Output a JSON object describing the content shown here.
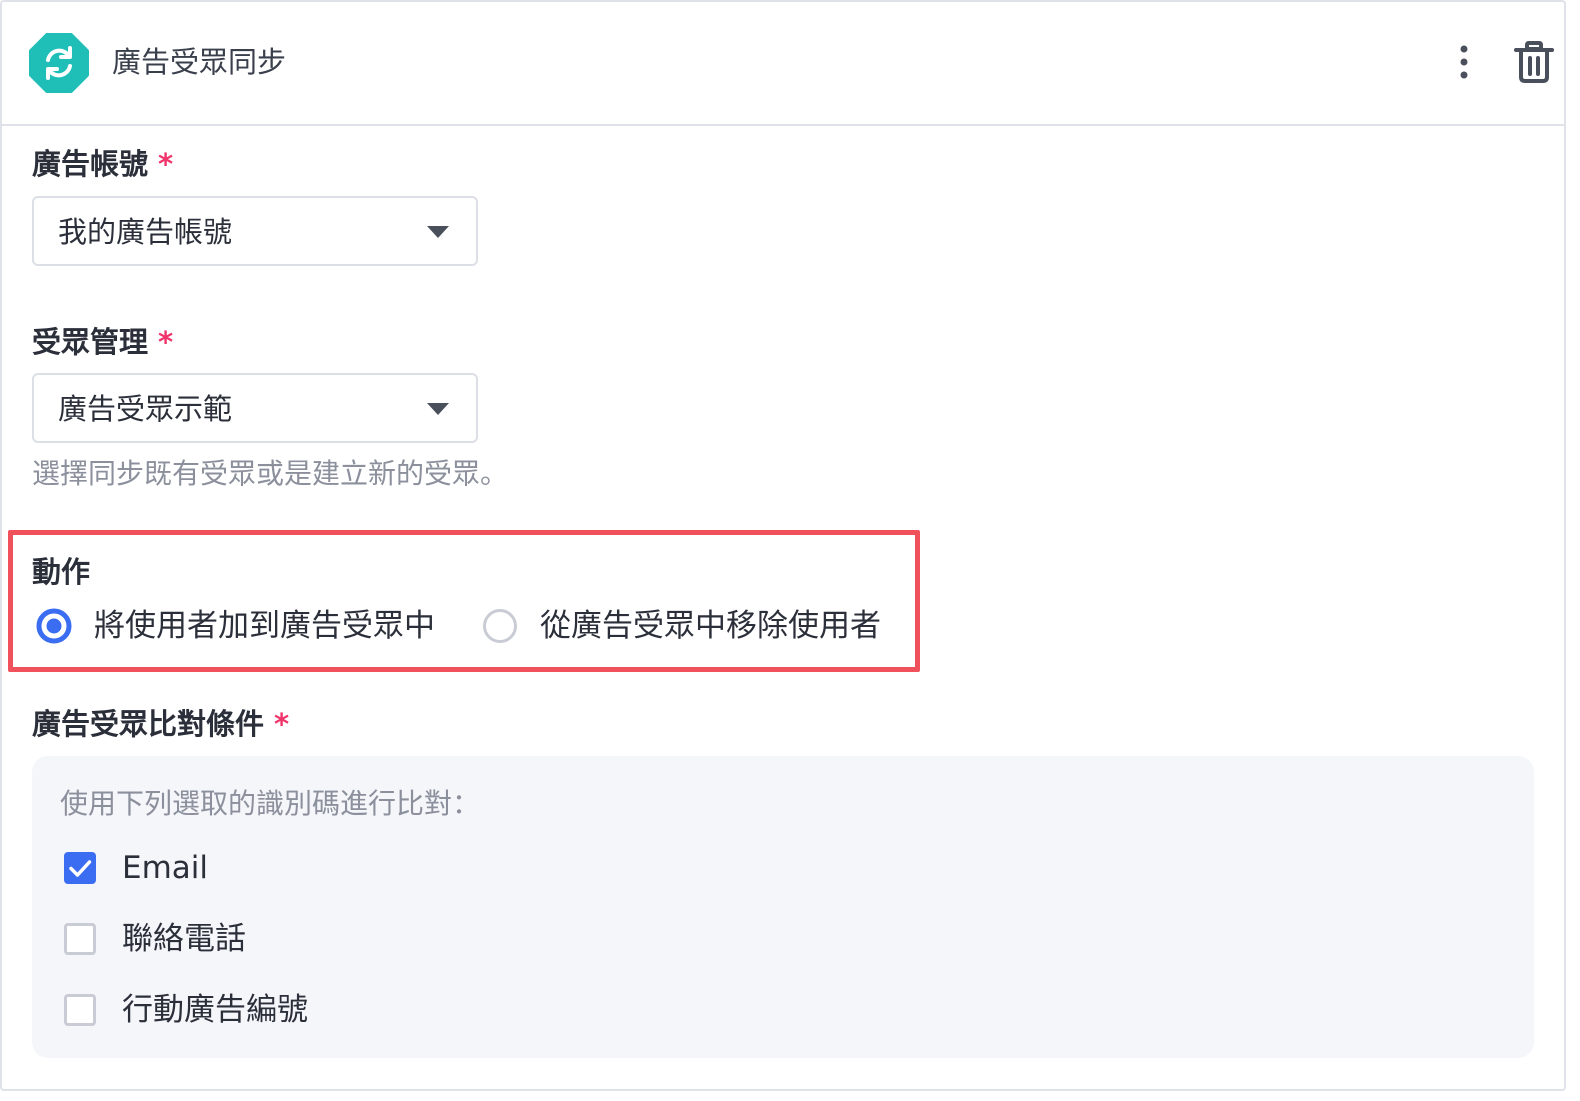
{
  "header": {
    "title": "廣告受眾同步",
    "logo_icon": "sync-icon",
    "menu_icon": "more-vertical-icon",
    "delete_icon": "trash-icon"
  },
  "ad_account": {
    "label": "廣告帳號",
    "required_mark": "*",
    "value": "我的廣告帳號"
  },
  "audience": {
    "label": "受眾管理",
    "required_mark": "*",
    "value": "廣告受眾示範",
    "helper": "選擇同步既有受眾或是建立新的受眾。"
  },
  "action": {
    "label": "動作",
    "options": [
      {
        "label": "將使用者加到廣告受眾中",
        "selected": true
      },
      {
        "label": "從廣告受眾中移除使用者",
        "selected": false
      }
    ]
  },
  "matching": {
    "label": "廣告受眾比對條件",
    "required_mark": "*",
    "note": "使用下列選取的識別碼進行比對：",
    "options": [
      {
        "label": "Email",
        "checked": true
      },
      {
        "label": "聯絡電話",
        "checked": false
      },
      {
        "label": "行動廣告編號",
        "checked": false
      }
    ]
  },
  "colors": {
    "accent": "#3b6df2",
    "logo": "#1fbfb8",
    "required": "#f0356b",
    "highlight": "#f0515a"
  }
}
